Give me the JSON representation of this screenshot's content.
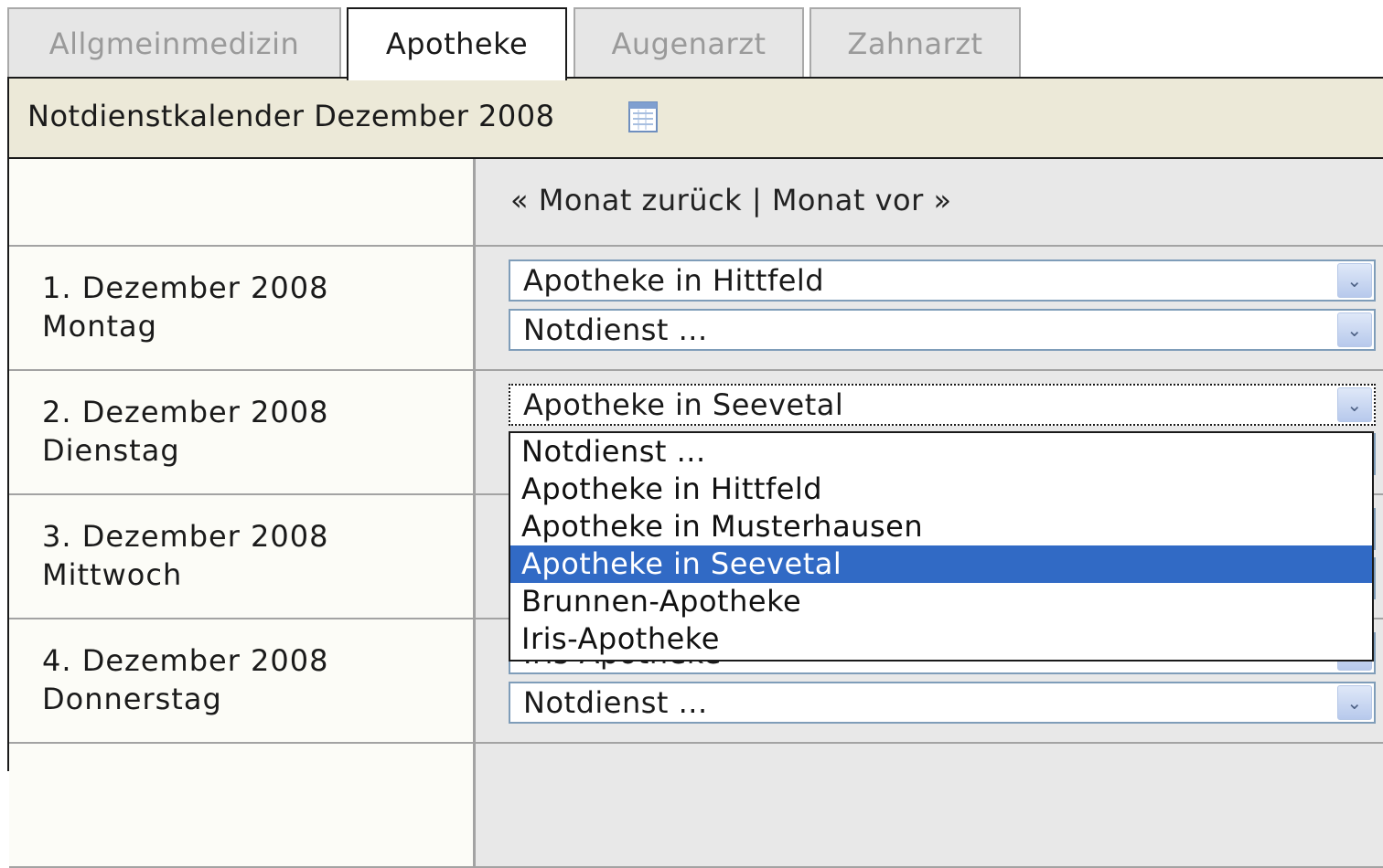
{
  "tabs": [
    {
      "label": "Allgmeinmedizin",
      "active": false
    },
    {
      "label": "Apotheke",
      "active": true
    },
    {
      "label": "Augenarzt",
      "active": false
    },
    {
      "label": "Zahnarzt",
      "active": false
    }
  ],
  "calendar": {
    "title": "Notdienstkalender Dezember 2008",
    "icon": "calendar-icon"
  },
  "nav": {
    "prev": "« Monat zurück",
    "separator": "|",
    "next": "Monat vor »"
  },
  "days": [
    {
      "date": "1. Dezember 2008",
      "weekday": "Montag",
      "select_1": "Apotheke in Hittfeld",
      "select_2": "Notdienst ..."
    },
    {
      "date": "2. Dezember 2008",
      "weekday": "Dienstag",
      "select_1": "Apotheke in Seevetal",
      "select_2": ""
    },
    {
      "date": "3. Dezember 2008",
      "weekday": "Mittwoch",
      "select_1": "",
      "select_2": ""
    },
    {
      "date": "4. Dezember 2008",
      "weekday": "Donnerstag",
      "select_1": "Iris-Apotheke",
      "select_2": "Notdienst ..."
    }
  ],
  "dropdown": {
    "options": [
      "Notdienst ...",
      "Apotheke in Hittfeld",
      "Apotheke in Musterhausen",
      "Apotheke in Seevetal",
      "Brunnen-Apotheke",
      "Iris-Apotheke"
    ],
    "selected_index": 3
  },
  "arrow_glyph": "⌄",
  "colors": {
    "header_bg": "#ece9d8",
    "selected_bg": "#316ac5",
    "select_border": "#7f9db9"
  }
}
